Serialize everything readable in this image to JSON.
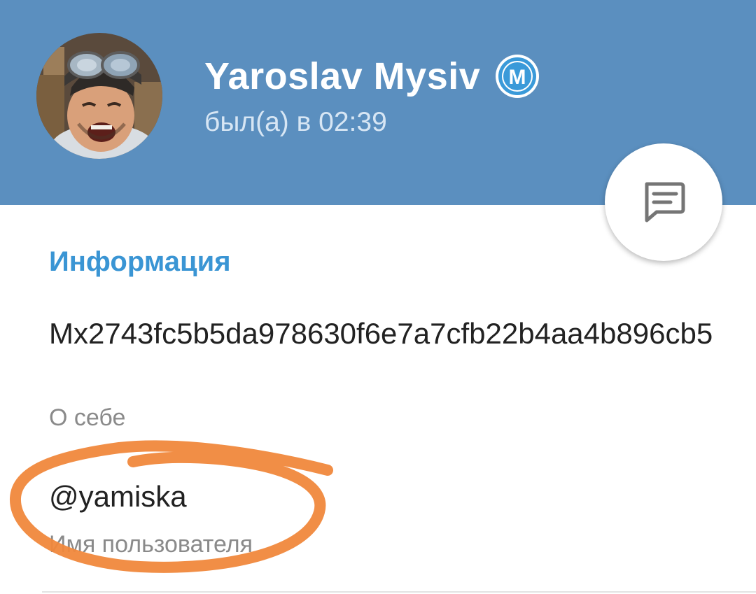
{
  "profile": {
    "name": "Yaroslav Mysiv",
    "badge_icon": "minter-m-badge-icon",
    "badge_letter": "M",
    "status": "был(а) в 02:39",
    "avatar_icon": "user-avatar-photo"
  },
  "actions": {
    "message_icon": "message-icon"
  },
  "info": {
    "section_title": "Информация",
    "bio_value": "Mx2743fc5b5da978630f6e7a7cfb22b4aa4b896cb5",
    "bio_caption": "О себе",
    "username_value": "@yamiska",
    "username_caption": "Имя пользователя"
  },
  "colors": {
    "header_bg": "#5b8fbf",
    "accent": "#3a95d4",
    "annotation": "#f0883c"
  }
}
